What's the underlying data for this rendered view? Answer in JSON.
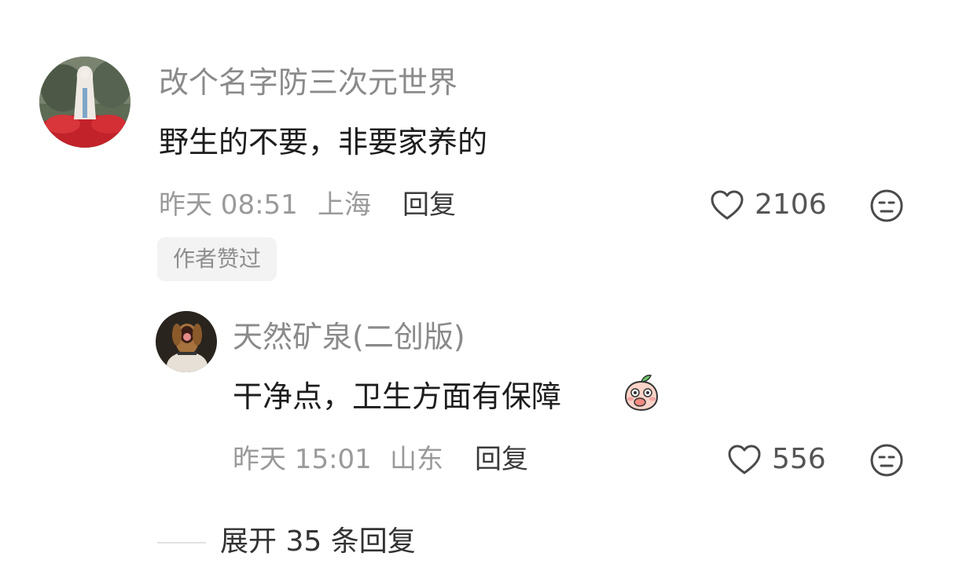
{
  "comments": [
    {
      "username": "改个名字防三次元世界",
      "text": "野生的不要，非要家养的",
      "time": "昨天 08:51",
      "location": "上海",
      "reply_label": "回复",
      "likes": "2106",
      "badge": "作者赞过"
    }
  ],
  "replies": [
    {
      "username": "天然矿泉(二创版)",
      "text": "干净点，卫生方面有保障",
      "time": "昨天 15:01",
      "location": "山东",
      "reply_label": "回复",
      "likes": "556",
      "emoji": "peach-face-emoji"
    }
  ],
  "expand": {
    "label": "展开 35 条回复"
  },
  "icons": {
    "like": "heart-icon",
    "dislike": "neutral-face-icon"
  },
  "colors": {
    "username": "#8a8a8a",
    "text": "#1d1d1d",
    "meta": "#9a9a9a",
    "badge_bg": "#f3f3f3"
  }
}
